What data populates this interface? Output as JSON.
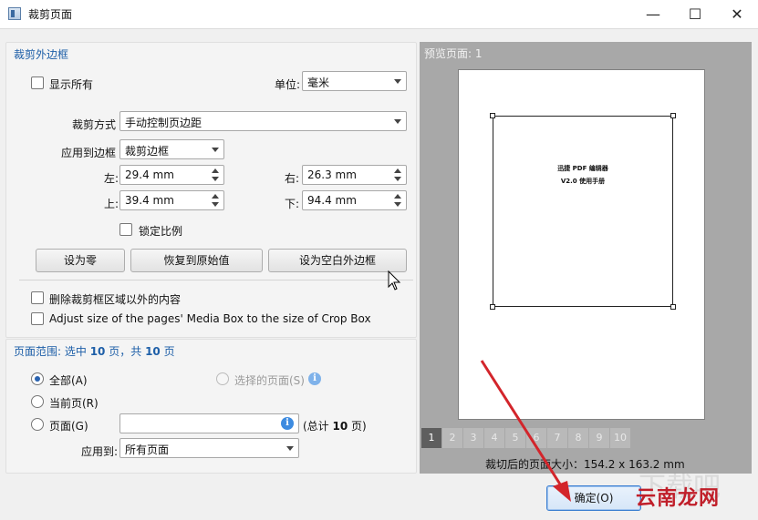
{
  "window": {
    "title": "裁剪页面",
    "min_label": "—",
    "max_label": "☐",
    "close_label": "✕"
  },
  "crop_margins": {
    "group_title": "裁剪外边框",
    "show_all_label": "显示所有",
    "unit_label": "单位:",
    "unit_value": "毫米",
    "crop_mode_label": "裁剪方式",
    "crop_mode_value": "手动控制页边距",
    "apply_to_box_label": "应用到边框",
    "apply_to_box_value": "裁剪边框",
    "left_label": "左:",
    "left_value": "29.4 mm",
    "right_label": "右:",
    "right_value": "26.3 mm",
    "top_label": "上:",
    "top_value": "39.4 mm",
    "bottom_label": "下:",
    "bottom_value": "94.4 mm",
    "lock_ratio_label": "锁定比例",
    "set_zero_label": "设为零",
    "restore_label": "恢复到原始值",
    "set_blank_label": "设为空白外边框",
    "delete_outside_label": "删除裁剪框区域以外的内容",
    "adjust_media_box_label": "Adjust size of the pages' Media Box to the size of Crop Box"
  },
  "page_range": {
    "title_prefix": "页面范围: 选中",
    "selected_count": "10",
    "title_mid": "页，共",
    "total_count": "10",
    "title_suffix": "页",
    "all_label": "全部(A)",
    "selected_pages_label": "选择的页面(S)",
    "current_page_label": "当前页(R)",
    "pages_label": "页面(G)",
    "pages_value": "",
    "total_prefix": "(总计",
    "total_value": "10",
    "total_suffix": "页)",
    "apply_to_label": "应用到:",
    "apply_to_value": "所有页面"
  },
  "preview": {
    "title": "预览页面: 1",
    "page_text_line1": "迅捷 PDF 编辑器",
    "page_text_line2": "V2.0 使用手册",
    "page_tabs": [
      "1",
      "2",
      "3",
      "4",
      "5",
      "6",
      "7",
      "8",
      "9",
      "10"
    ],
    "active_page": "1",
    "cropped_size_text": "裁切后的页面大小：154.2 x 163.2 mm"
  },
  "footer": {
    "ok_label": "确定(O)"
  },
  "overlay": {
    "watermark_text": "云南龙网",
    "watermark_ghost": "下载吧",
    "arrow_color": "#d3252b"
  }
}
